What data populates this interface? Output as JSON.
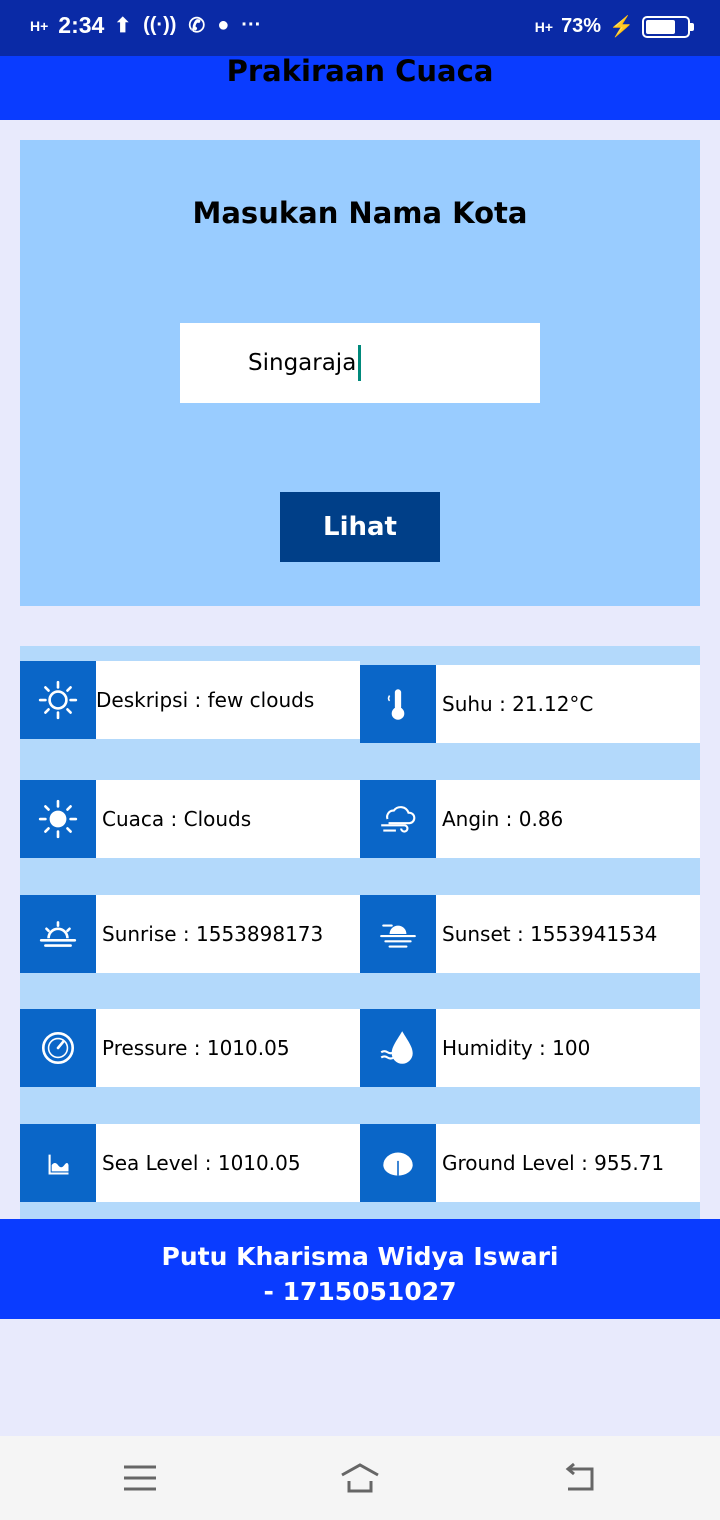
{
  "status_bar": {
    "network": "H+",
    "time": "2:34",
    "right_network": "H+",
    "battery": "73%",
    "battery_level": 0.73
  },
  "app_bar": {
    "title": "Prakiraan Cuaca"
  },
  "search": {
    "heading": "Masukan Nama Kota",
    "input_value": "Singaraja",
    "button_label": "Lihat"
  },
  "info": {
    "deskripsi": "Deskripsi : few clouds",
    "suhu": "Suhu : 21.12°C",
    "cuaca": "Cuaca : Clouds",
    "angin": "Angin : 0.86",
    "sunrise": "Sunrise : 1553898173",
    "sunset": "Sunset : 1553941534",
    "pressure": "Pressure : 1010.05",
    "humidity": "Humidity : 100",
    "sea_level": "Sea Level : 1010.05",
    "ground_level": "Ground Level : 955.71"
  },
  "footer": {
    "line1": "Putu Kharisma Widya Iswari",
    "line2": "- 1715051027"
  },
  "colors": {
    "status_bar": "#0a2aa6",
    "app_bar": "#0a3cff",
    "card": "#99ccff",
    "button": "#003f88",
    "icon_bg": "#0a66c8",
    "panel": "#b3d9fb"
  }
}
